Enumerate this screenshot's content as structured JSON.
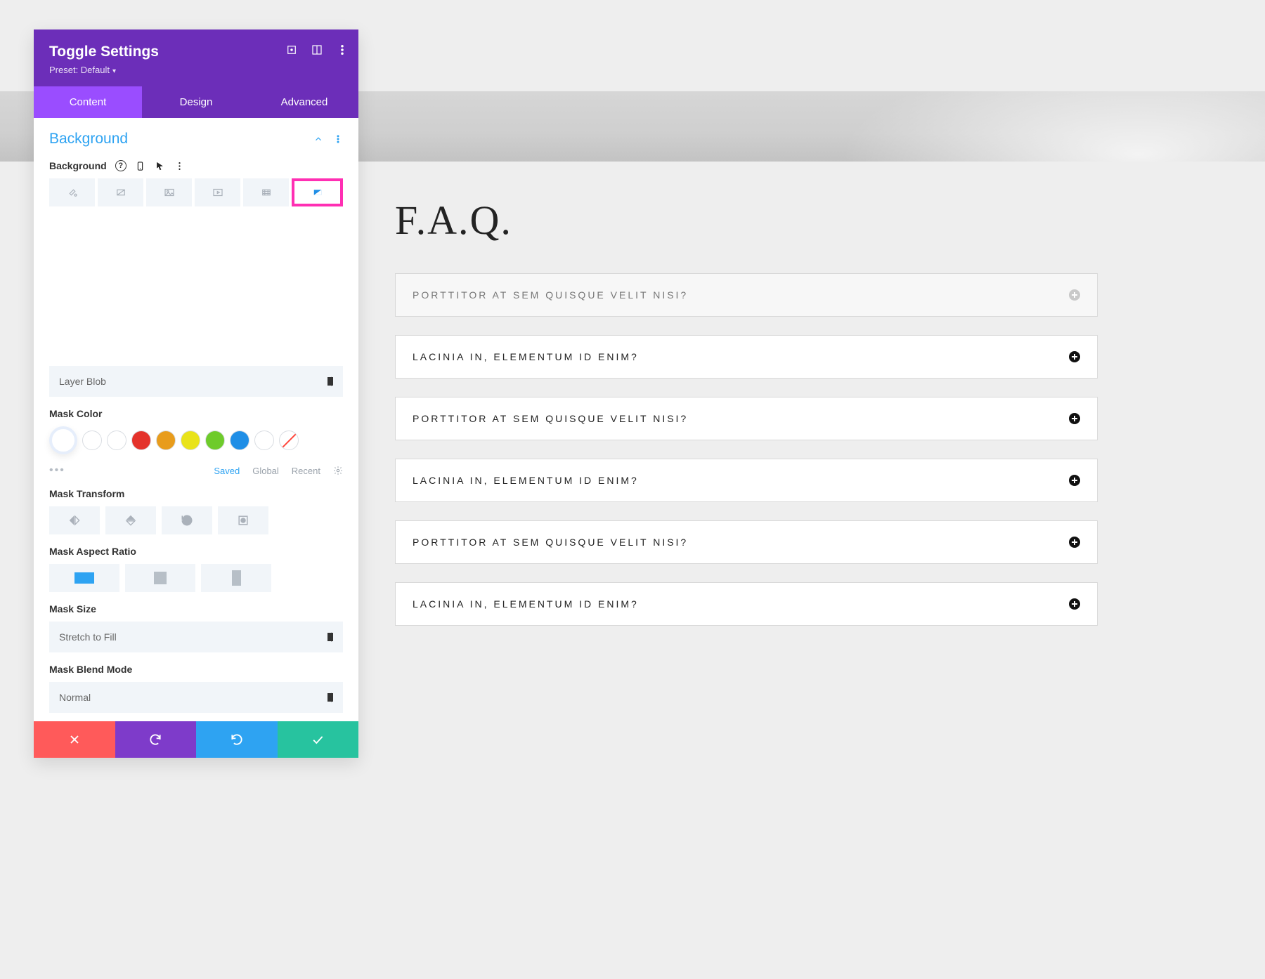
{
  "panel": {
    "title": "Toggle Settings",
    "preset": "Preset: Default",
    "tabs": {
      "content": "Content",
      "design": "Design",
      "advanced": "Advanced"
    },
    "section_title": "Background",
    "bg_label": "Background",
    "mask_shape_select": "Layer Blob",
    "mask_color_label": "Mask Color",
    "swatch_tabs": {
      "saved": "Saved",
      "global": "Global",
      "recent": "Recent"
    },
    "mask_transform_label": "Mask Transform",
    "mask_aspect_ratio_label": "Mask Aspect Ratio",
    "mask_size_label": "Mask Size",
    "mask_size_value": "Stretch to Fill",
    "mask_blend_label": "Mask Blend Mode",
    "mask_blend_value": "Normal",
    "swatches": [
      "#ffffff",
      "#ffffff",
      "#ffffff",
      "#e4322b",
      "#e89c1c",
      "#e9e31a",
      "#6ecb2b",
      "#1f8ee6",
      "#ffffff"
    ]
  },
  "faq": {
    "heading": "F.A.Q.",
    "items": [
      "PORTTITOR AT SEM QUISQUE VELIT NISI?",
      "LACINIA IN, ELEMENTUM ID ENIM?",
      "PORTTITOR AT SEM QUISQUE VELIT NISI?",
      "LACINIA IN, ELEMENTUM ID ENIM?",
      "PORTTITOR AT SEM QUISQUE VELIT NISI?",
      "LACINIA IN, ELEMENTUM ID ENIM?"
    ]
  }
}
